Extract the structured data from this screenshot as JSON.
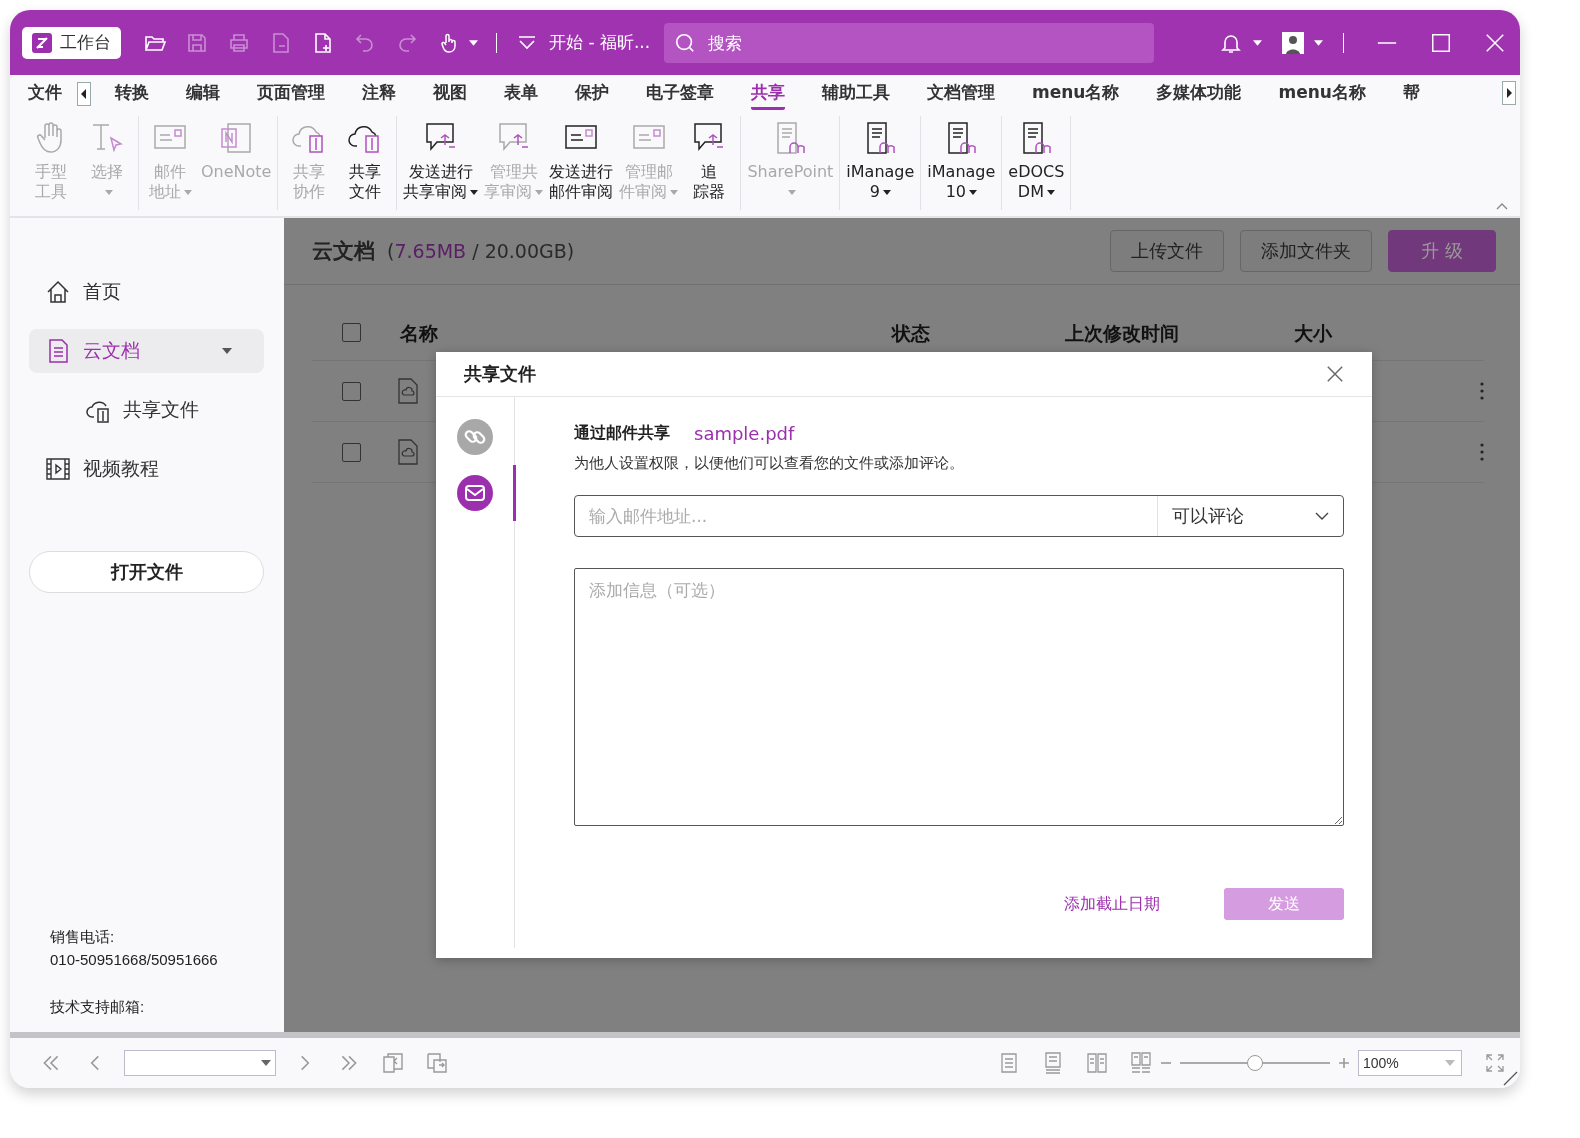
{
  "title_bar": {
    "workbench": "工作台",
    "title": "开始 - 福昕...",
    "search_placeholder": "搜索",
    "toolbar": [
      {
        "disabled": false
      },
      {
        "disabled": true
      },
      {
        "disabled": true
      },
      {
        "disabled": true
      },
      {
        "disabled": false
      },
      {
        "disabled": true
      },
      {
        "disabled": true
      },
      {
        "disabled": false
      }
    ]
  },
  "menu_tabs": [
    {
      "label": "文件",
      "selected": false
    },
    {
      "label": "转换",
      "selected": false
    },
    {
      "label": "编辑",
      "selected": false
    },
    {
      "label": "页面管理",
      "selected": false
    },
    {
      "label": "注释",
      "selected": false
    },
    {
      "label": "视图",
      "selected": false
    },
    {
      "label": "表单",
      "selected": false
    },
    {
      "label": "保护",
      "selected": false
    },
    {
      "label": "电子签章",
      "selected": false
    },
    {
      "label": "共享",
      "selected": true
    },
    {
      "label": "辅助工具",
      "selected": false
    },
    {
      "label": "文档管理",
      "selected": false
    },
    {
      "label": "menu名称",
      "selected": false
    },
    {
      "label": "多媒体功能",
      "selected": false
    },
    {
      "label": "menu名称",
      "selected": false
    },
    {
      "label": "帮",
      "selected": false
    }
  ],
  "ribbon": [
    {
      "items": [
        {
          "lines": [
            "手型",
            "工具"
          ],
          "disabled": true,
          "dropdown": false
        },
        {
          "lines": [
            "选择"
          ],
          "disabled": true,
          "dropdown": true
        }
      ]
    },
    {
      "items": [
        {
          "lines": [
            "邮件",
            "地址"
          ],
          "disabled": true,
          "dropdown": true
        },
        {
          "lines": [
            "OneNote"
          ],
          "disabled": true,
          "dropdown": false
        }
      ]
    },
    {
      "items": [
        {
          "lines": [
            "共享",
            "协作"
          ],
          "disabled": true,
          "dropdown": false
        },
        {
          "lines": [
            "共享",
            "文件"
          ],
          "disabled": false,
          "dropdown": false
        }
      ]
    },
    {
      "items": [
        {
          "lines": [
            "发送进行",
            "共享审阅"
          ],
          "disabled": false,
          "dropdown": true
        },
        {
          "lines": [
            "管理共",
            "享审阅"
          ],
          "disabled": true,
          "dropdown": true
        },
        {
          "lines": [
            "发送进行",
            "邮件审阅"
          ],
          "disabled": false,
          "dropdown": false
        },
        {
          "lines": [
            "管理邮",
            "件审阅"
          ],
          "disabled": true,
          "dropdown": true
        },
        {
          "lines": [
            "追",
            "踪器"
          ],
          "disabled": false,
          "dropdown": false
        }
      ]
    },
    {
      "items": [
        {
          "lines": [
            "SharePoint"
          ],
          "disabled": true,
          "dropdown": true
        }
      ]
    },
    {
      "items": [
        {
          "lines": [
            "iManage",
            "9"
          ],
          "disabled": false,
          "dropdown": true
        }
      ]
    },
    {
      "items": [
        {
          "lines": [
            "iManage",
            "10"
          ],
          "disabled": false,
          "dropdown": true
        }
      ]
    },
    {
      "items": [
        {
          "lines": [
            "eDOCS",
            "DM"
          ],
          "disabled": false,
          "dropdown": true
        }
      ]
    }
  ],
  "sidebar": {
    "items": [
      {
        "label": "首页",
        "selected": false
      },
      {
        "label": "云文档",
        "selected": true,
        "expanded": true,
        "children": [
          {
            "label": "共享文件",
            "selected": false
          }
        ]
      },
      {
        "label": "视频教程",
        "selected": false
      }
    ],
    "open_button": "打开文件",
    "sales_label": "销售电话:",
    "sales_phone": "010-50951668/50951666",
    "support_label": "技术支持邮箱:"
  },
  "content": {
    "title": "云文档",
    "quota_parts": [
      {
        "text": "(",
        "highlight": false
      },
      {
        "text": "7.65MB",
        "highlight": true
      },
      {
        "text": " / 20.00GB)",
        "highlight": false
      }
    ],
    "buttons": [
      {
        "label": "上传文件",
        "primary": false
      },
      {
        "label": "添加文件夹",
        "primary": false
      },
      {
        "label": "升 级",
        "primary": true
      }
    ],
    "table": {
      "header_checked": false,
      "columns": [
        "名称",
        "状态",
        "上次修改时间",
        "大小"
      ],
      "rows": [
        {
          "checked": false
        },
        {
          "checked": false
        }
      ]
    }
  },
  "dialog": {
    "title": "共享文件",
    "modes": [
      {
        "kind": "link",
        "selected": false
      },
      {
        "kind": "mail",
        "selected": true
      }
    ],
    "heading": "通过邮件共享",
    "file": "sample.pdf",
    "description": "为他人设置权限，以便他们可以查看您的文件或添加评论。",
    "email_placeholder": "输入邮件地址...",
    "permission": "可以评论",
    "message_placeholder": "添加信息（可选）",
    "deadline_link": "添加截止日期",
    "send_button": "发送",
    "send_disabled": true
  },
  "status_bar": {
    "zoom_level": "100%",
    "zoom": {
      "level": 0.5
    }
  }
}
